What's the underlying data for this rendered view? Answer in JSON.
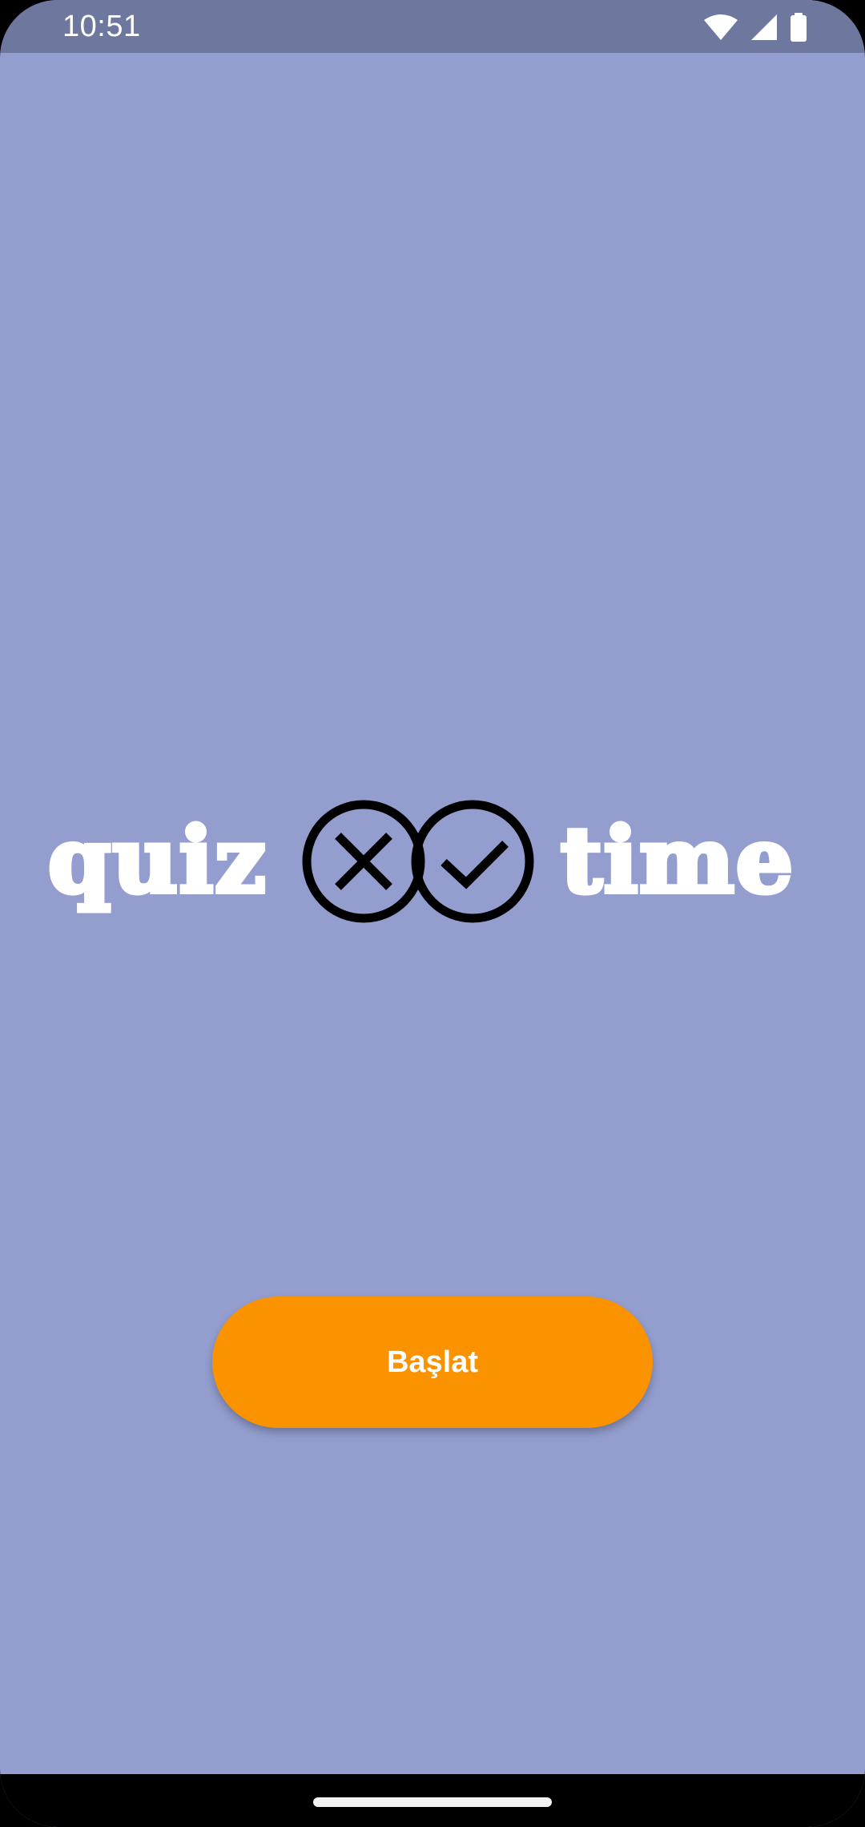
{
  "status_bar": {
    "time": "10:51",
    "icons": [
      "wifi-icon",
      "cellular-signal-icon",
      "battery-icon"
    ]
  },
  "logo": {
    "word_left": "quiz",
    "word_right": "time",
    "mark_icons": [
      "close-circle-icon",
      "check-circle-icon"
    ]
  },
  "main": {
    "start_button_label": "Başlat"
  },
  "colors": {
    "background": "#939ecf",
    "status_bar": "#6e789f",
    "button": "#fb9300",
    "text": "#ffffff"
  }
}
